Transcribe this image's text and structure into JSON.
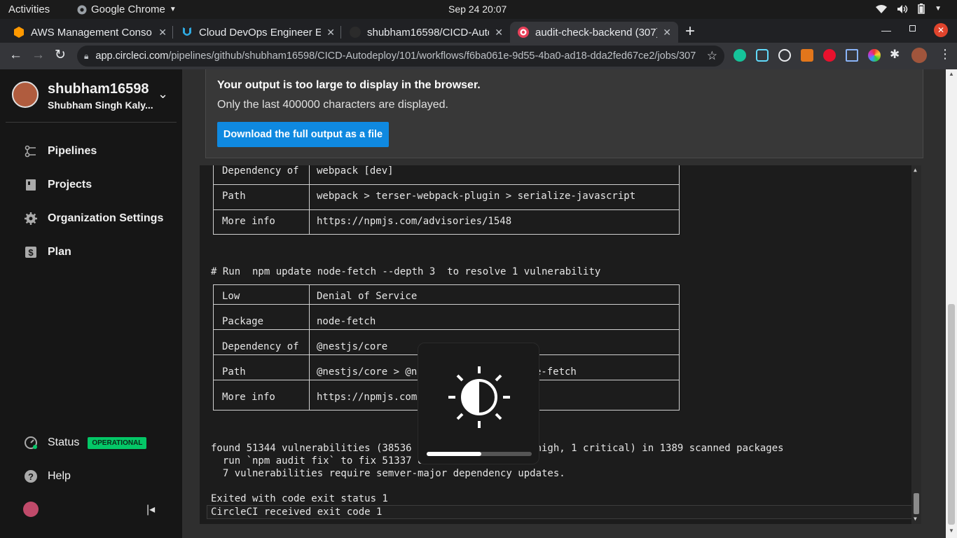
{
  "topbar": {
    "activities": "Activities",
    "app_name": "Google Chrome",
    "clock": "Sep 24  20:07"
  },
  "tabs": [
    {
      "title": "AWS Management Conso",
      "icon": "aws-icon"
    },
    {
      "title": "Cloud DevOps Engineer E",
      "icon": "udacity-icon"
    },
    {
      "title": "shubham16598/CICD-Auto",
      "icon": "github-icon"
    },
    {
      "title": "audit-check-backend (307)",
      "icon": "circleci-icon",
      "active": true
    }
  ],
  "address": {
    "host": "app.circleci.com",
    "path": "/pipelines/github/shubham16598/CICD-Autodeploy/101/workflows/f6ba061e-9d55-4ba0-ad18-dda2fed67ce2/jobs/307"
  },
  "sidebar": {
    "username": "shubham16598",
    "fullname": "Shubham Singh Kaly...",
    "items": [
      {
        "label": "Pipelines",
        "icon": "pipelines-icon"
      },
      {
        "label": "Projects",
        "icon": "projects-icon"
      },
      {
        "label": "Organization Settings",
        "icon": "gear-icon"
      },
      {
        "label": "Plan",
        "icon": "dollar-icon"
      }
    ],
    "status_label": "Status",
    "status_badge": "OPERATIONAL",
    "help_label": "Help"
  },
  "banner": {
    "title": "Your output is too large to display in the browser.",
    "subtitle": "Only the last 400000 characters are displayed.",
    "download_label": "Download the full output as a file"
  },
  "console": {
    "table1": [
      {
        "key": "Dependency of",
        "value": "webpack [dev]"
      },
      {
        "key": "Path",
        "value": "webpack > terser-webpack-plugin > serialize-javascript"
      },
      {
        "key": "More info",
        "value": "https://npmjs.com/advisories/1548"
      }
    ],
    "run_line": "# Run  npm update node-fetch --depth 3  to resolve 1 vulnerability",
    "table2": [
      {
        "key": "Low",
        "value": "Denial of Service"
      },
      {
        "key": "Package",
        "value": "node-fetch"
      },
      {
        "key": "Dependency of",
        "value": "@nestjs/core"
      },
      {
        "key": "Path",
        "value": "@nestjs/core > @n               > node-fetch"
      },
      {
        "key": "More info",
        "value": "https://npmjs.com"
      }
    ],
    "found_line": "found 51344 vulnerabilities (38536                   5 high, 1 critical) in 1389 scanned packages",
    "fix_line": "  run `npm audit fix` to fix 51337 o",
    "semver_line": "  7 vulnerabilities require semver-major dependency updates.",
    "exit_line": "Exited with code exit status 1",
    "received_line": "CircleCI received exit code 1"
  },
  "osd": {
    "icon": "brightness-icon",
    "level": 0.52
  }
}
